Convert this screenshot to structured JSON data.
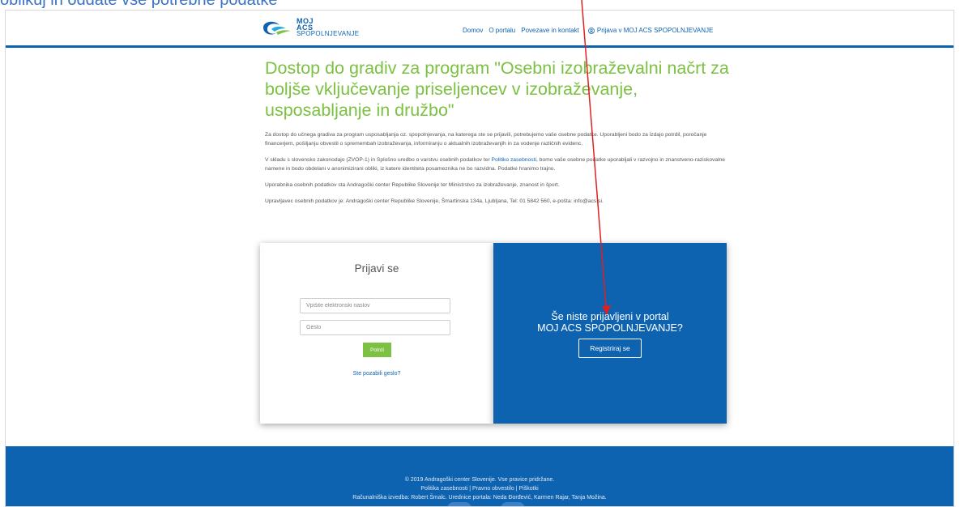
{
  "caption": "oblikuj in oddate vse potrebne podatke",
  "header": {
    "logo_line1": "MOJ",
    "logo_line2": "ACS",
    "logo_line3": "SPOPOLNJEVANJE",
    "nav": {
      "home": "Domov",
      "about": "O portalu",
      "links": "Povezave in kontakt",
      "login": "Prijava v MOJ ACS SPOPOLNJEVANJE"
    }
  },
  "main": {
    "title": "Dostop do gradiv za program \"Osebni izobraževalni načrt za boljše vključevanje priseljencev v izobraževanje, usposabljanje in družbo\"",
    "p1": "Za dostop do učnega gradiva za program usposabljanja oz. spopolnjevanja, na katerega ste se prijavili, potrebujemo vaše osebne podatke. Uporabljeni bodo za izdajo potrdil, poročanje financerjem, pošiljanju obvestil o spremembah izobraževanja, informiranju o aktualnih izobraževanjih in za vodenje različnih evidenc.",
    "p2_before": "V skladu s slovensko zakonodajo (ZVOP-1) in Splošno uredbo o varstvu osebnih podatkov ter ",
    "p2_link": "Politiko zasebnosti",
    "p2_after": ", bomo vaše osebne podatke uporabljali v razvojno in znanstveno-raziskovalne namene in bodo obdelani v anonimizirani obliki, iz katere identiteta posameznika ne bo razvidna. Podatke hranimo trajno.",
    "p3": "Uporabnika osebnih podatkov sta Andragoški center Republike Slovenije ter Ministrstvo za izobraževanje, znanost in šport.",
    "p4": "Upravljavec osebnih podatkov je: Andragoški center Republike Slovenije, Šmartinska 134a, Ljubljana, Tel: 01 5842 560, e-pošta: info@acs.si."
  },
  "login": {
    "title": "Prijavi se",
    "email_placeholder": "Vpišite elektronski naslov",
    "password_placeholder": "Geslo",
    "submit": "Potrdi",
    "forgot": "Ste pozabili geslo?"
  },
  "register": {
    "line1": "Še niste prijavljeni v portal",
    "line2": "MOJ ACS SPOPOLNJEVANJE?",
    "button": "Registriraj se"
  },
  "footer": {
    "copyright": "© 2019 Andragoški center Slovenije. Vse pravice pridržane.",
    "policy_links": "Politika zasebnosti | Pravno obvestilo | Piškotki",
    "credits": "Računalniška izvedba: Robert Šmalc. Urednice portala: Neda Đorđević, Karmen Rajar, Tanja Možina."
  },
  "colors": {
    "brand_blue": "#0e63b0",
    "accent_green": "#7cc142",
    "annotation_red": "#e02020"
  }
}
